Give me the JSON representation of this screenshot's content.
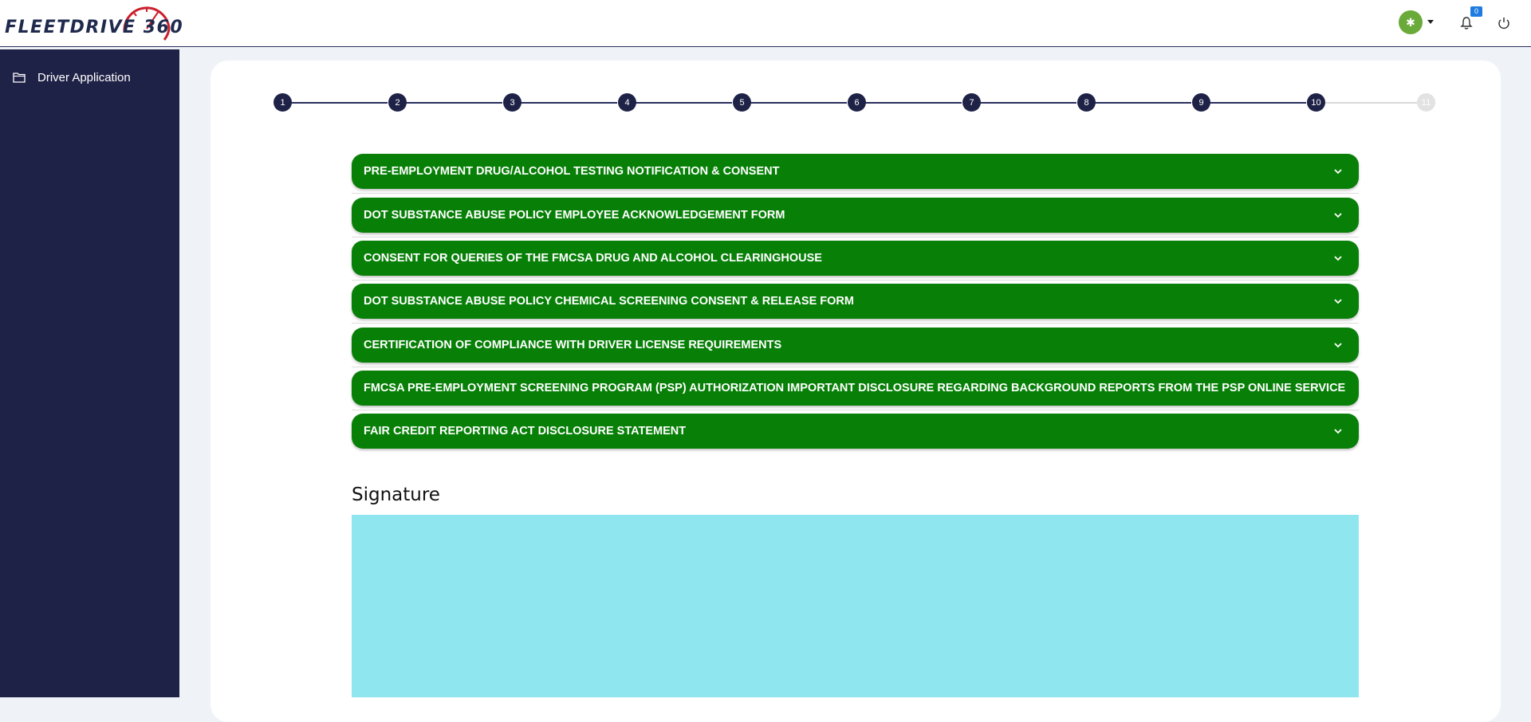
{
  "app": {
    "logo_text": "FLEETDRIVE 360"
  },
  "header": {
    "avatar_glyph": "✱",
    "notification_count": "0"
  },
  "sidebar": {
    "items": [
      {
        "label": "Driver Application",
        "icon": "folder-icon"
      }
    ]
  },
  "stepper": {
    "steps": [
      "1",
      "2",
      "3",
      "4",
      "5",
      "6",
      "7",
      "8",
      "9",
      "10",
      "11"
    ],
    "current_step": 10,
    "total_steps": 11
  },
  "accordions": [
    {
      "label": "PRE-EMPLOYMENT DRUG/ALCOHOL TESTING NOTIFICATION & CONSENT"
    },
    {
      "label": "DOT SUBSTANCE ABUSE POLICY EMPLOYEE ACKNOWLEDGEMENT FORM"
    },
    {
      "label": "CONSENT FOR QUERIES OF THE FMCSA DRUG AND ALCOHOL CLEARINGHOUSE"
    },
    {
      "label": "DOT SUBSTANCE ABUSE POLICY CHEMICAL SCREENING CONSENT & RELEASE FORM"
    },
    {
      "label": "CERTIFICATION OF COMPLIANCE WITH DRIVER LICENSE REQUIREMENTS"
    },
    {
      "label": "FMCSA PRE-EMPLOYMENT SCREENING PROGRAM (PSP) AUTHORIZATION IMPORTANT DISCLOSURE REGARDING BACKGROUND REPORTS FROM THE PSP ONLINE SERVICE"
    },
    {
      "label": "FAIR CREDIT REPORTING ACT DISCLOSURE STATEMENT"
    }
  ],
  "signature": {
    "title": "Signature"
  },
  "colors": {
    "accordion_bg": "#088008",
    "sidebar_bg": "#1f2247",
    "signature_pad_bg": "#8fe6ef",
    "step_active": "#1f2247",
    "step_inactive": "#e2e2e2"
  }
}
